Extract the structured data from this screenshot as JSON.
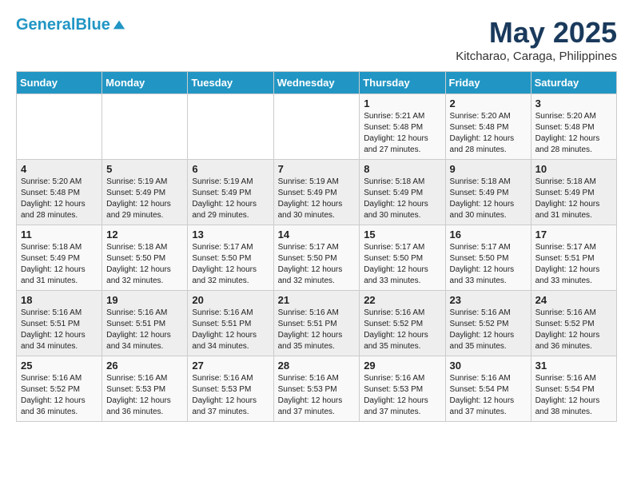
{
  "header": {
    "logo_line1": "General",
    "logo_line2": "Blue",
    "month": "May 2025",
    "location": "Kitcharao, Caraga, Philippines"
  },
  "days_of_week": [
    "Sunday",
    "Monday",
    "Tuesday",
    "Wednesday",
    "Thursday",
    "Friday",
    "Saturday"
  ],
  "weeks": [
    [
      {
        "day": "",
        "info": ""
      },
      {
        "day": "",
        "info": ""
      },
      {
        "day": "",
        "info": ""
      },
      {
        "day": "",
        "info": ""
      },
      {
        "day": "1",
        "info": "Sunrise: 5:21 AM\nSunset: 5:48 PM\nDaylight: 12 hours\nand 27 minutes."
      },
      {
        "day": "2",
        "info": "Sunrise: 5:20 AM\nSunset: 5:48 PM\nDaylight: 12 hours\nand 28 minutes."
      },
      {
        "day": "3",
        "info": "Sunrise: 5:20 AM\nSunset: 5:48 PM\nDaylight: 12 hours\nand 28 minutes."
      }
    ],
    [
      {
        "day": "4",
        "info": "Sunrise: 5:20 AM\nSunset: 5:48 PM\nDaylight: 12 hours\nand 28 minutes."
      },
      {
        "day": "5",
        "info": "Sunrise: 5:19 AM\nSunset: 5:49 PM\nDaylight: 12 hours\nand 29 minutes."
      },
      {
        "day": "6",
        "info": "Sunrise: 5:19 AM\nSunset: 5:49 PM\nDaylight: 12 hours\nand 29 minutes."
      },
      {
        "day": "7",
        "info": "Sunrise: 5:19 AM\nSunset: 5:49 PM\nDaylight: 12 hours\nand 30 minutes."
      },
      {
        "day": "8",
        "info": "Sunrise: 5:18 AM\nSunset: 5:49 PM\nDaylight: 12 hours\nand 30 minutes."
      },
      {
        "day": "9",
        "info": "Sunrise: 5:18 AM\nSunset: 5:49 PM\nDaylight: 12 hours\nand 30 minutes."
      },
      {
        "day": "10",
        "info": "Sunrise: 5:18 AM\nSunset: 5:49 PM\nDaylight: 12 hours\nand 31 minutes."
      }
    ],
    [
      {
        "day": "11",
        "info": "Sunrise: 5:18 AM\nSunset: 5:49 PM\nDaylight: 12 hours\nand 31 minutes."
      },
      {
        "day": "12",
        "info": "Sunrise: 5:18 AM\nSunset: 5:50 PM\nDaylight: 12 hours\nand 32 minutes."
      },
      {
        "day": "13",
        "info": "Sunrise: 5:17 AM\nSunset: 5:50 PM\nDaylight: 12 hours\nand 32 minutes."
      },
      {
        "day": "14",
        "info": "Sunrise: 5:17 AM\nSunset: 5:50 PM\nDaylight: 12 hours\nand 32 minutes."
      },
      {
        "day": "15",
        "info": "Sunrise: 5:17 AM\nSunset: 5:50 PM\nDaylight: 12 hours\nand 33 minutes."
      },
      {
        "day": "16",
        "info": "Sunrise: 5:17 AM\nSunset: 5:50 PM\nDaylight: 12 hours\nand 33 minutes."
      },
      {
        "day": "17",
        "info": "Sunrise: 5:17 AM\nSunset: 5:51 PM\nDaylight: 12 hours\nand 33 minutes."
      }
    ],
    [
      {
        "day": "18",
        "info": "Sunrise: 5:16 AM\nSunset: 5:51 PM\nDaylight: 12 hours\nand 34 minutes."
      },
      {
        "day": "19",
        "info": "Sunrise: 5:16 AM\nSunset: 5:51 PM\nDaylight: 12 hours\nand 34 minutes."
      },
      {
        "day": "20",
        "info": "Sunrise: 5:16 AM\nSunset: 5:51 PM\nDaylight: 12 hours\nand 34 minutes."
      },
      {
        "day": "21",
        "info": "Sunrise: 5:16 AM\nSunset: 5:51 PM\nDaylight: 12 hours\nand 35 minutes."
      },
      {
        "day": "22",
        "info": "Sunrise: 5:16 AM\nSunset: 5:52 PM\nDaylight: 12 hours\nand 35 minutes."
      },
      {
        "day": "23",
        "info": "Sunrise: 5:16 AM\nSunset: 5:52 PM\nDaylight: 12 hours\nand 35 minutes."
      },
      {
        "day": "24",
        "info": "Sunrise: 5:16 AM\nSunset: 5:52 PM\nDaylight: 12 hours\nand 36 minutes."
      }
    ],
    [
      {
        "day": "25",
        "info": "Sunrise: 5:16 AM\nSunset: 5:52 PM\nDaylight: 12 hours\nand 36 minutes."
      },
      {
        "day": "26",
        "info": "Sunrise: 5:16 AM\nSunset: 5:53 PM\nDaylight: 12 hours\nand 36 minutes."
      },
      {
        "day": "27",
        "info": "Sunrise: 5:16 AM\nSunset: 5:53 PM\nDaylight: 12 hours\nand 37 minutes."
      },
      {
        "day": "28",
        "info": "Sunrise: 5:16 AM\nSunset: 5:53 PM\nDaylight: 12 hours\nand 37 minutes."
      },
      {
        "day": "29",
        "info": "Sunrise: 5:16 AM\nSunset: 5:53 PM\nDaylight: 12 hours\nand 37 minutes."
      },
      {
        "day": "30",
        "info": "Sunrise: 5:16 AM\nSunset: 5:54 PM\nDaylight: 12 hours\nand 37 minutes."
      },
      {
        "day": "31",
        "info": "Sunrise: 5:16 AM\nSunset: 5:54 PM\nDaylight: 12 hours\nand 38 minutes."
      }
    ]
  ]
}
